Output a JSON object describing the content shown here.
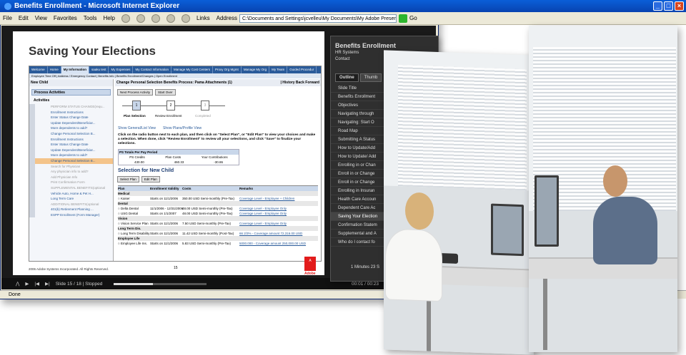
{
  "ie": {
    "title": "Benefits Enrollment - Microsoft Internet Explorer",
    "menu": [
      "File",
      "Edit",
      "View",
      "Favorites",
      "Tools",
      "Help"
    ],
    "links_label": "Links",
    "address_label": "Address",
    "address_value": "C:\\Documents and Settings\\jcvelleu\\My Documents\\My Adobe Presentations\\Benefits Enrollme",
    "go_label": "Go",
    "status": "Done"
  },
  "slide": {
    "title": "Saving Your Elections",
    "nav_tabs": [
      "Welcome",
      "Home",
      "My Information",
      "saaku test",
      "My Expenses",
      "My Contact Information",
      "Manage My Cost Centers",
      "Proxy Org Mgmt",
      "Manage My Org",
      "My Team",
      "Guided Procedur"
    ],
    "subtabs": "Employee Time Off | Address / Emergency Contact | Benefits Info | Benefits Enrollment/Changes | Open Enrollment",
    "left_header": "New Child",
    "process_activities": "Process Activities",
    "activities_label": "Activities",
    "activities": [
      {
        "label": "PERFORM STATUS CHANGE(requ...",
        "style": "grey"
      },
      {
        "label": "Enrollment Instructions",
        "style": ""
      },
      {
        "label": "Enter Status Change Date",
        "style": ""
      },
      {
        "label": "Update Dependent/Beneficiar...",
        "style": ""
      },
      {
        "label": "More dependents to add?",
        "style": ""
      },
      {
        "label": "Change Personal Selection B...",
        "style": ""
      },
      {
        "label": "Enrollment Instructions",
        "style": ""
      },
      {
        "label": "Enter Status Change Date",
        "style": ""
      },
      {
        "label": "Update Dependent/Beneficiar...",
        "style": ""
      },
      {
        "label": "More dependents to add?",
        "style": ""
      },
      {
        "label": "Change Personal Selection B...",
        "style": "hl"
      },
      {
        "label": "Search for Physician",
        "style": "grey"
      },
      {
        "label": "Any physician info to add?",
        "style": "grey"
      },
      {
        "label": "Add Physician Info",
        "style": "grey"
      },
      {
        "label": "Print Confirmation Form",
        "style": "grey"
      },
      {
        "label": "SUPPLEMENTAL BENEFITS(optional",
        "style": "grey"
      },
      {
        "label": "Vehicle Auto, Home & Pet H...",
        "style": ""
      },
      {
        "label": "Long Term Care",
        "style": ""
      },
      {
        "label": "ADDITIONAL BENEFITS(optional",
        "style": "grey"
      },
      {
        "label": "401(k) Retirement Planning ...",
        "style": ""
      },
      {
        "label": "ESPP Enrollment (Form Manager)",
        "style": ""
      }
    ],
    "right_header": "Change Personal Selection Benefits   Process: Pama   Attachments (1)",
    "history_links": "| History  Back  Forward",
    "next_activity": "Next Process Activity",
    "start_over": "Start Over",
    "steps": [
      {
        "num": "1",
        "label": "Plan Selection"
      },
      {
        "num": "2",
        "label": "Review Enrollment"
      },
      {
        "num": "3",
        "label": "Completed"
      }
    ],
    "link_general": "Show General/List View",
    "link_plans": "Show Plans/Profile View",
    "instructions": "Click on the radio button next to each plan, and then click on \"Select Plan\", or \"Edit Plan\" to view your choices and make a selection. When done, click \"Review Enrollment\" to review all your selections, and click \"Save\" to finalize your selections.",
    "totals_title": "PS Totals Per Pay Period",
    "totals_headers": [
      "PS Credits",
      "Plan Costs",
      "Your Contributions"
    ],
    "totals_values": [
      "430.00",
      "460.33",
      "-30.86"
    ],
    "selection_title": "Selection for New Child",
    "select_plan": "Select Plan",
    "edit_plan": "Edit Plan",
    "grid_headers": [
      "Plan",
      "Enrollment Validity",
      "Costs",
      "Remarks"
    ],
    "grid_rows": [
      {
        "type": "cat",
        "cells": [
          "Medical",
          "",
          "",
          ""
        ]
      },
      {
        "type": "row",
        "cells": [
          "Kaiser",
          "Starts on 11/1/2006",
          "350.00 USD Semi-monthly (Pre-Tax)",
          "Coverage Level - Employee + Children"
        ]
      },
      {
        "type": "cat",
        "cells": [
          "Dental",
          "",
          "",
          ""
        ]
      },
      {
        "type": "row",
        "cells": [
          "Delta Dental",
          "11/1/2006 - 12/31/2006",
          "48.00 USD Semi-monthly (Pre-Tax)",
          "Coverage Level - Employee Only"
        ]
      },
      {
        "type": "row",
        "cells": [
          "USG Dental",
          "Starts on 1/1/2007",
          "48.00 USD Semi-monthly (Pre-Tax)",
          "Coverage Level - Employee Only"
        ]
      },
      {
        "type": "cat",
        "cells": [
          "Vision",
          "",
          "",
          ""
        ]
      },
      {
        "type": "row",
        "cells": [
          "Vision Service Plan",
          "Starts on 11/1/2006",
          "7.50 USD Semi-monthly (Pre-Tax)",
          "Coverage Level - Employee Only"
        ]
      },
      {
        "type": "cat",
        "cells": [
          "Long Term Dis.",
          "",
          "",
          ""
        ]
      },
      {
        "type": "row",
        "cells": [
          "Long Term Disability",
          "Starts on 11/1/2006",
          "11.42 USD Semi-monthly (Post-Tax)",
          "66 2/3% - Coverage amount 72,316.00 USD"
        ]
      },
      {
        "type": "cat",
        "cells": [
          "Employee Life",
          "",
          "",
          ""
        ]
      },
      {
        "type": "row",
        "cells": [
          "Employee Life Ins.",
          "Starts on 11/1/2006",
          "5.83 USD Semi-monthly (Pre-Tax)",
          "5000.000 - Coverage amount 250,000.00 USD"
        ]
      }
    ],
    "copyright": "2006 Adobe Systems Incorporated.  All Rights Reserved.",
    "page_number": "15",
    "adobe_label": "Adobe"
  },
  "controls": {
    "slide_status": "Slide 15 / 18 | Stopped",
    "time": "00:01 / 00:23",
    "progress": 0.42
  },
  "outline": {
    "title": "Benefits Enrollment",
    "org": "HR Systems",
    "contact": "Contact",
    "tabs": [
      "Outline",
      "Thumb"
    ],
    "items": [
      {
        "label": "Slide Title",
        "cur": false
      },
      {
        "label": "Benefits Enrollment",
        "cur": false
      },
      {
        "label": "Objectives",
        "cur": false
      },
      {
        "label": "Navigating through",
        "cur": false
      },
      {
        "label": "Navigating: Start O",
        "cur": false
      },
      {
        "label": "Road Map",
        "cur": false
      },
      {
        "label": "Submitting A Status",
        "cur": false
      },
      {
        "label": "How to Update/Add",
        "cur": false
      },
      {
        "label": "How to Update/ Add",
        "cur": false
      },
      {
        "label": "Enrolling in or Chan",
        "cur": false
      },
      {
        "label": "Enroll in or Change",
        "cur": false
      },
      {
        "label": "Enroll in or Change",
        "cur": false
      },
      {
        "label": "Enrolling in Insuran",
        "cur": false
      },
      {
        "label": "Health Care Accoun",
        "cur": false
      },
      {
        "label": "Dependent Care Ac",
        "cur": false
      },
      {
        "label": "Saving Your Election",
        "cur": true
      },
      {
        "label": "Confirmation Statem",
        "cur": false
      },
      {
        "label": "Supplemental and A",
        "cur": false
      },
      {
        "label": "Who do I contact fo",
        "cur": false
      }
    ],
    "timer": "1 Minutes 23 S"
  }
}
